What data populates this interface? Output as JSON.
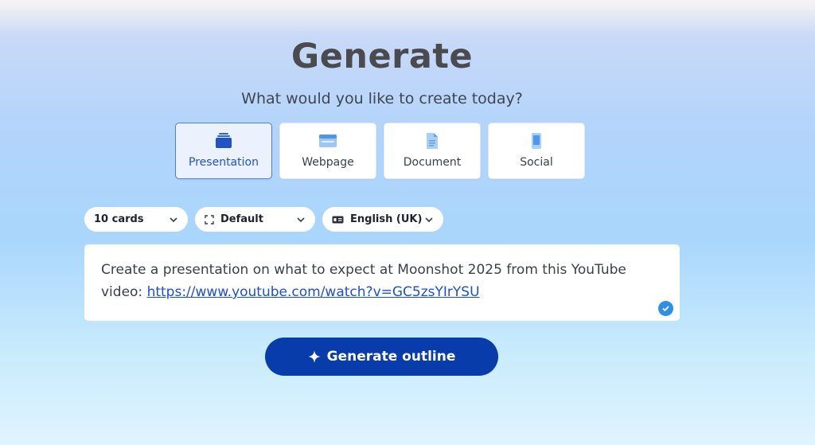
{
  "header": {
    "title": "Generate",
    "subtitle": "What would you like to create today?"
  },
  "types": [
    {
      "label": "Presentation",
      "icon": "presentation-icon",
      "selected": true
    },
    {
      "label": "Webpage",
      "icon": "webpage-icon",
      "selected": false
    },
    {
      "label": "Document",
      "icon": "document-icon",
      "selected": false
    },
    {
      "label": "Social",
      "icon": "social-icon",
      "selected": false
    }
  ],
  "options": {
    "cards": "10 cards",
    "theme": "Default",
    "language": "English (UK)"
  },
  "prompt": {
    "text": "Create a presentation on what to expect at Moonshot 2025 from this YouTube video: ",
    "link": "https://www.youtube.com/watch?v=GC5zsYIrYSU"
  },
  "actions": {
    "generate_label": "Generate outline"
  },
  "colors": {
    "accent": "#073caa",
    "selected_border": "#4a7fe6",
    "link": "#1d4fd1"
  }
}
